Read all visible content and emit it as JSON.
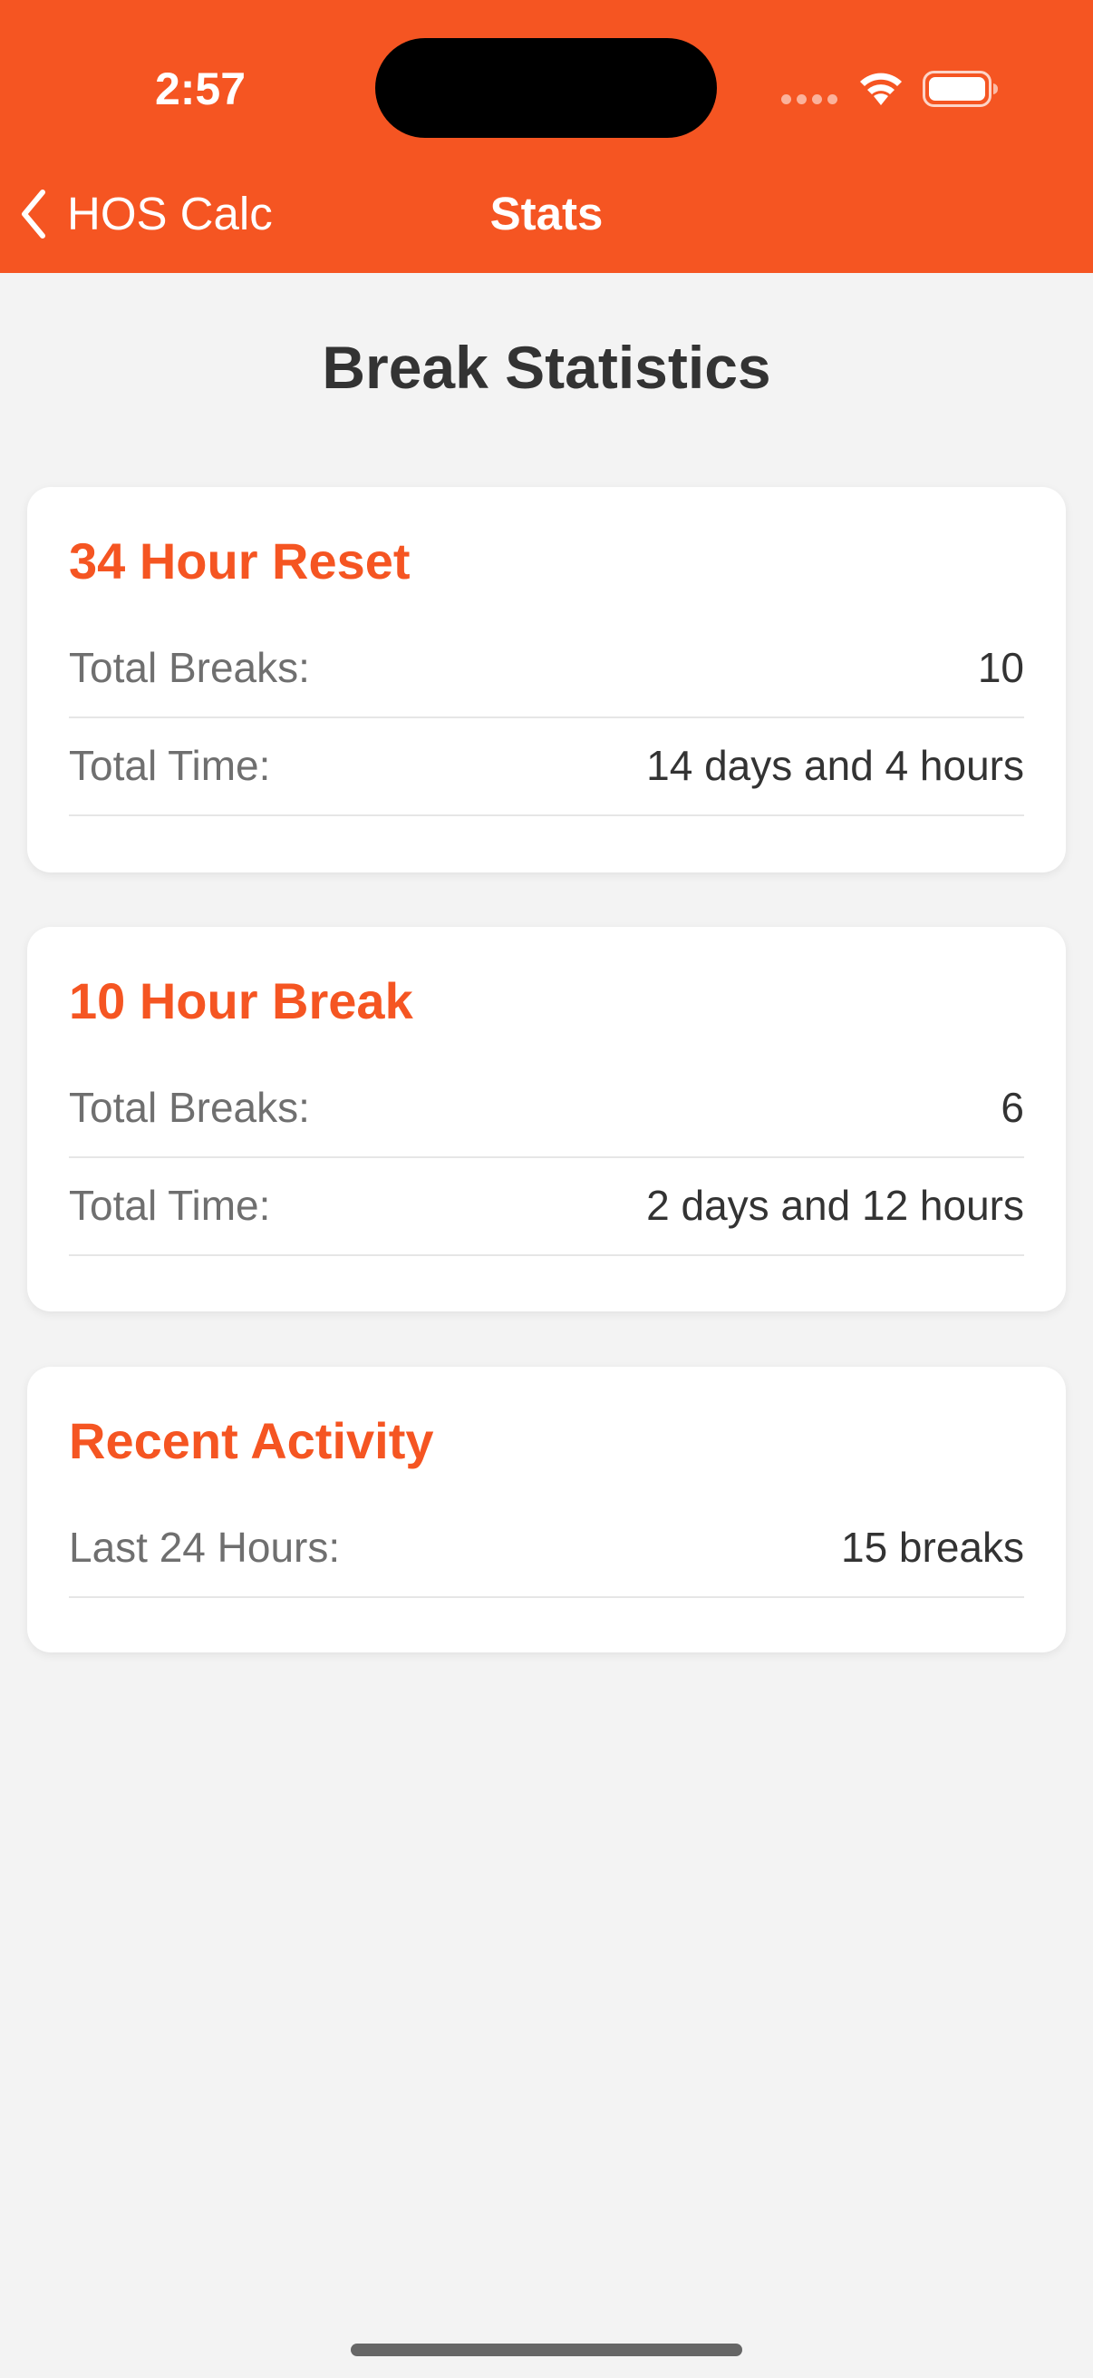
{
  "status_bar": {
    "time": "2:57"
  },
  "nav": {
    "back_label": "HOS Calc",
    "title": "Stats"
  },
  "page": {
    "title": "Break Statistics"
  },
  "colors": {
    "accent": "#f55522",
    "background": "#f3f3f3",
    "card": "#ffffff"
  },
  "cards": [
    {
      "title": "34 Hour Reset",
      "rows": [
        {
          "label": "Total Breaks:",
          "value": "10"
        },
        {
          "label": "Total Time:",
          "value": "14 days and 4 hours"
        }
      ]
    },
    {
      "title": "10 Hour Break",
      "rows": [
        {
          "label": "Total Breaks:",
          "value": "6"
        },
        {
          "label": "Total Time:",
          "value": "2 days and 12 hours"
        }
      ]
    },
    {
      "title": "Recent Activity",
      "rows": [
        {
          "label": "Last 24 Hours:",
          "value": "15 breaks"
        }
      ]
    }
  ],
  "icons": [
    "chevron-left-icon",
    "signal-icon",
    "wifi-icon",
    "battery-icon"
  ]
}
